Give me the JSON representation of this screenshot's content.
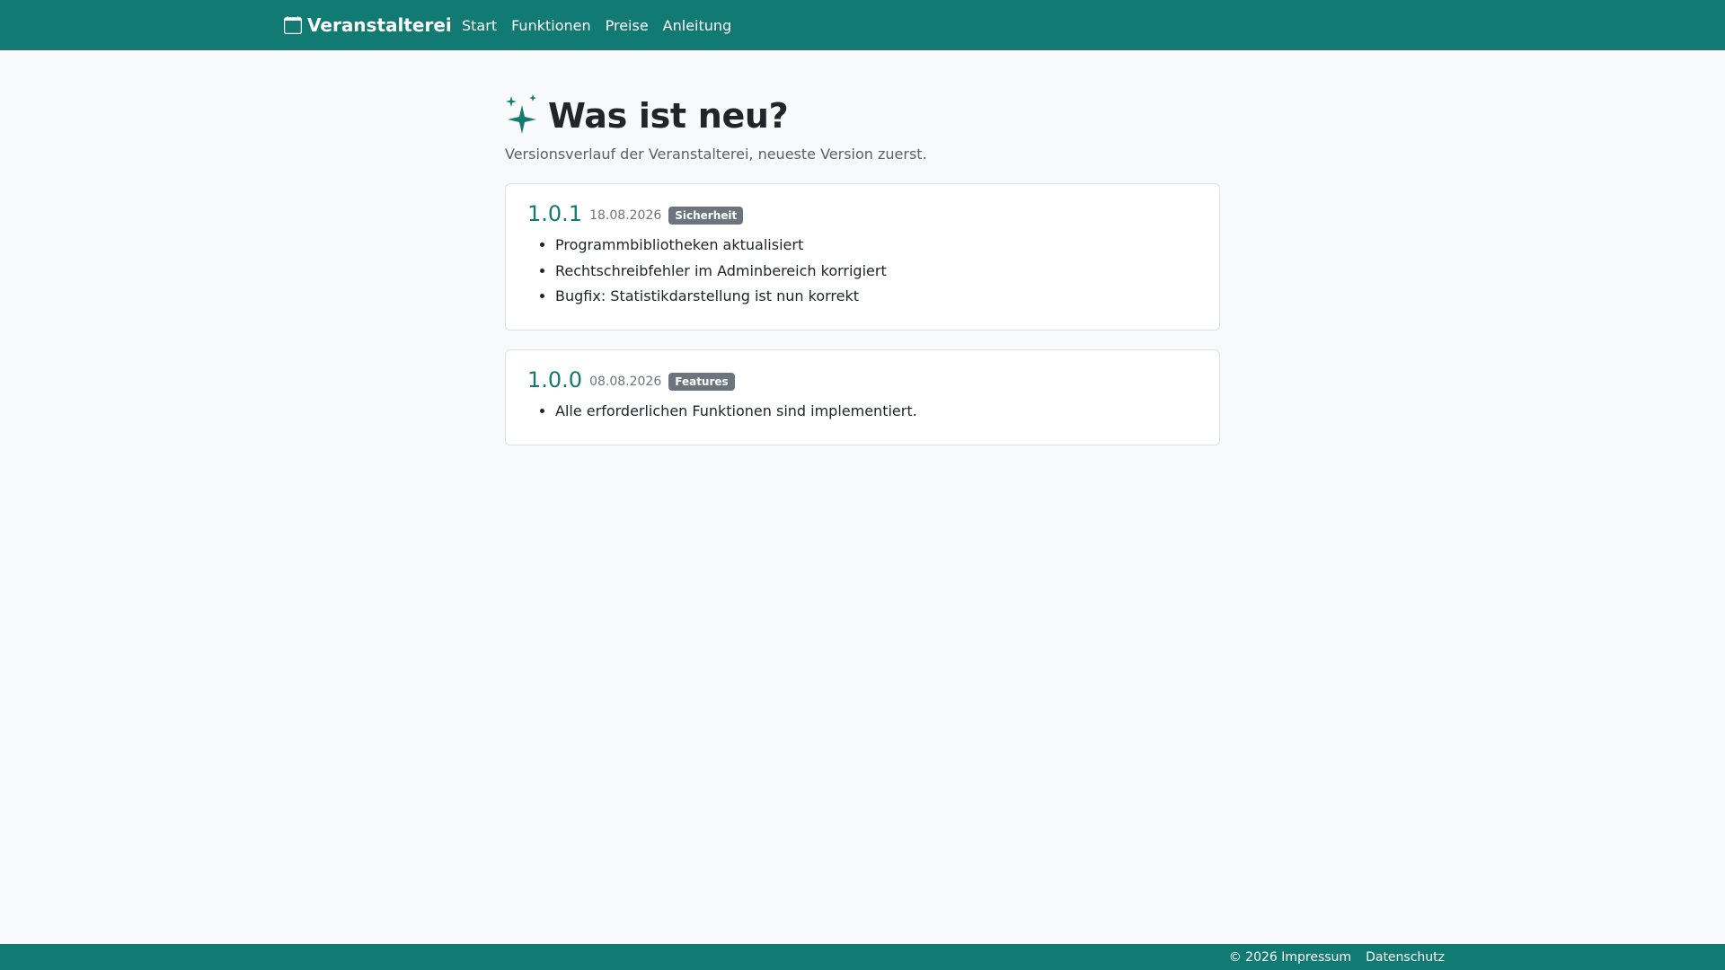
{
  "navbar": {
    "brand": "Veranstalterei",
    "brand_icon": "calendar-icon",
    "items": [
      {
        "label": "Start"
      },
      {
        "label": "Funktionen"
      },
      {
        "label": "Preise"
      },
      {
        "label": "Anleitung"
      }
    ],
    "background": "#117a72"
  },
  "page": {
    "title_icon": "sparkles-icon",
    "title": "Was ist neu?",
    "subtitle": "Versionsverlauf der Veranstalterei, neueste Version zuerst."
  },
  "releases": [
    {
      "version": "1.0.1",
      "date": "18.08.2026",
      "tag": "Sicherheit",
      "changes": [
        "Programmbibliotheken aktualisiert",
        "Rechtschreibfehler im Adminbereich korrigiert",
        "Bugfix: Statistikdarstellung ist nun korrekt"
      ]
    },
    {
      "version": "1.0.0",
      "date": "08.08.2026",
      "tag": "Features",
      "changes": [
        "Alle erforderlichen Funktionen sind implementiert."
      ]
    }
  ],
  "footer": {
    "copyright": "© 2026",
    "impressum": "Impressum",
    "datenschutz": "Datenschutz"
  },
  "colors": {
    "accent": "#117a72",
    "badge": "#6c757d"
  }
}
